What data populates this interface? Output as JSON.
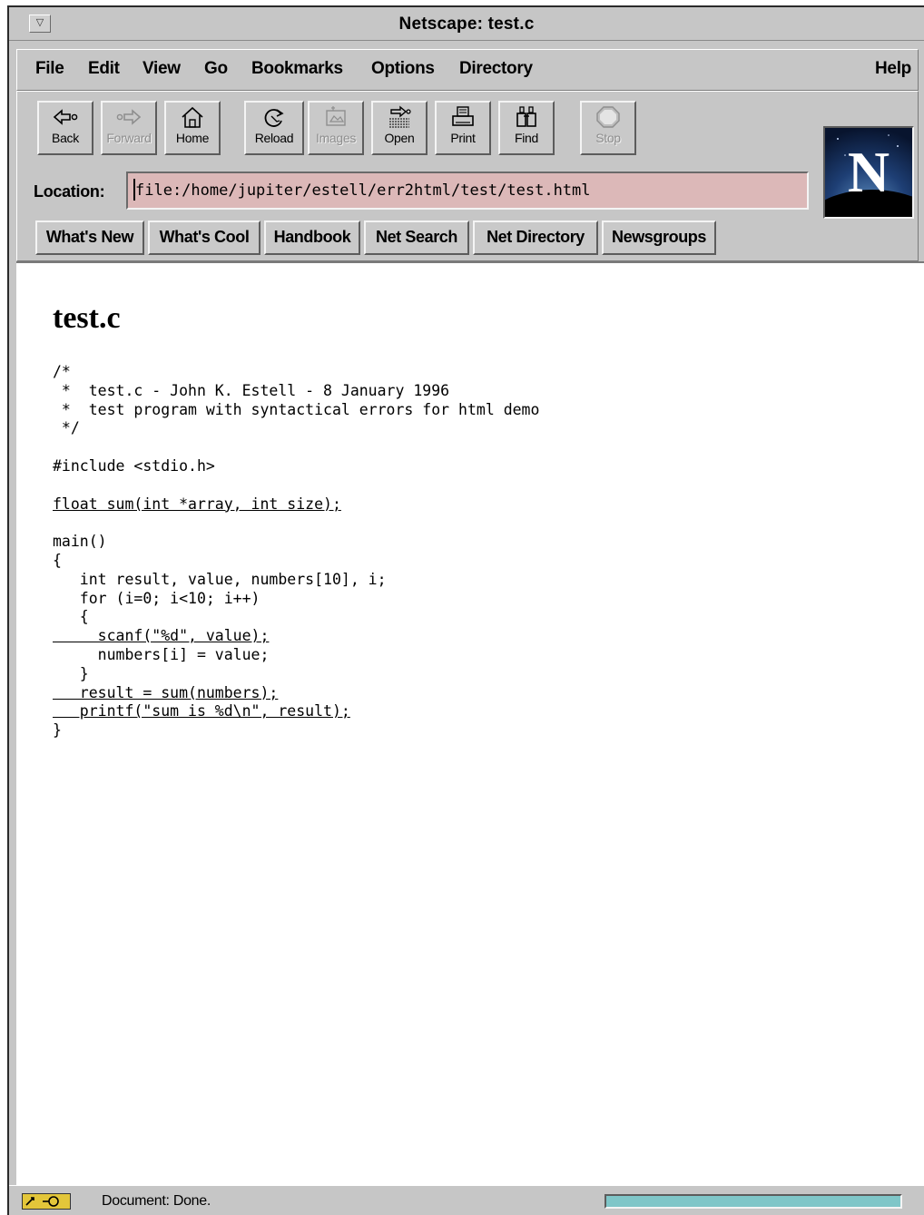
{
  "window": {
    "title": "Netscape: test.c"
  },
  "menubar": {
    "file": "File",
    "edit": "Edit",
    "view": "View",
    "go": "Go",
    "bookmarks": "Bookmarks",
    "options": "Options",
    "directory": "Directory",
    "help": "Help"
  },
  "toolbar": {
    "back": "Back",
    "forward": "Forward",
    "home": "Home",
    "reload": "Reload",
    "images": "Images",
    "open": "Open",
    "print": "Print",
    "find": "Find",
    "stop": "Stop"
  },
  "location": {
    "label": "Location:",
    "value": "file:/home/jupiter/estell/err2html/test/test.html"
  },
  "directory_buttons": {
    "whats_new": "What's New",
    "whats_cool": "What's Cool",
    "handbook": "Handbook",
    "net_search": "Net Search",
    "net_directory": "Net Directory",
    "newsgroups": "Newsgroups"
  },
  "document": {
    "title": "test.c",
    "code": {
      "l1": "/*",
      "l2": " *  test.c - John K. Estell - 8 January 1996",
      "l3": " *  test program with syntactical errors for html demo",
      "l4": " */",
      "l5": "",
      "l6": "#include <stdio.h>",
      "l7": "",
      "l8": "float sum(int *array, int size);",
      "l9": "",
      "l10": "main()",
      "l11": "{",
      "l12": "   int result, value, numbers[10], i;",
      "l13": "   for (i=0; i<10; i++)",
      "l14": "   {",
      "l15": "     scanf(\"%d\", value);",
      "l16": "     numbers[i] = value;",
      "l17": "   }",
      "l18": "   result = sum(numbers);",
      "l19": "   printf(\"sum is %d\\n\", result);",
      "l20": "}"
    }
  },
  "status": {
    "text": "Document: Done."
  },
  "colors": {
    "chrome": "#c6c6c6",
    "location_bg": "#dcb8b8",
    "progress": "#7fc6c8"
  },
  "icons": {
    "back": "arrow-left-icon",
    "forward": "arrow-right-icon",
    "home": "house-icon",
    "reload": "reload-icon",
    "images": "images-icon",
    "open": "open-icon",
    "print": "printer-icon",
    "find": "binoculars-icon",
    "stop": "stop-icon",
    "logo": "netscape-n-logo",
    "security": "key-icon"
  }
}
